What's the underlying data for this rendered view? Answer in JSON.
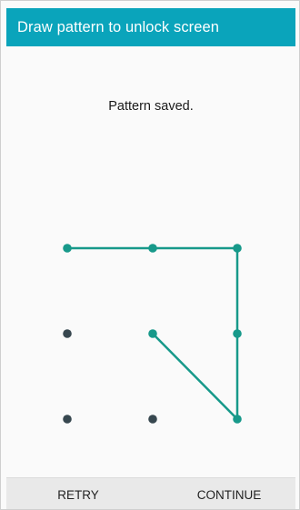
{
  "header": {
    "title": "Draw pattern to unlock screen"
  },
  "main": {
    "status_message": "Pattern saved."
  },
  "pattern": {
    "grid_size": 3,
    "selected_sequence": [
      0,
      1,
      2,
      5,
      8,
      4
    ],
    "colors": {
      "selected_dot": "#17998a",
      "unselected_dot": "#37474f",
      "path": "#17998a"
    }
  },
  "actions": {
    "retry_label": "RETRY",
    "continue_label": "CONTINUE"
  },
  "colors": {
    "header_background": "#0aa4bb",
    "header_text": "#ffffff",
    "content_background": "#fafafa",
    "bottom_bar_background": "#e9e9e9"
  }
}
